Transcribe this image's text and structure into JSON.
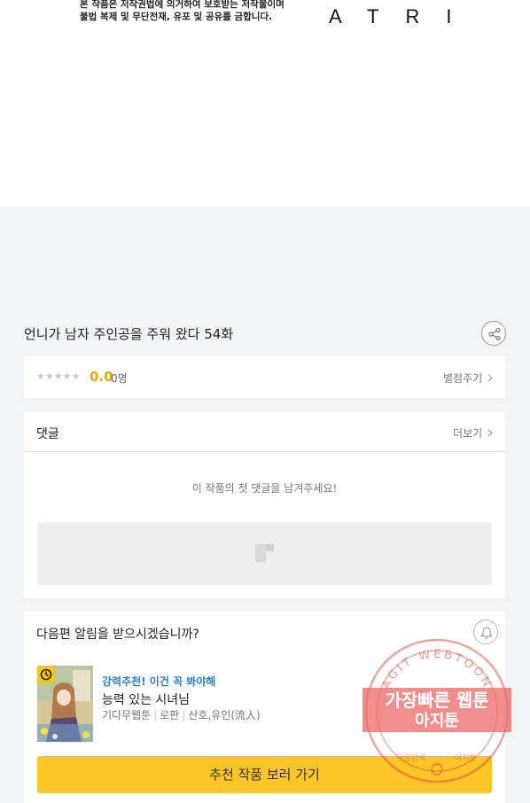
{
  "viewer": {
    "copyright_line1": "본 작품은 저작권법에 의거하여 보호받는 저작물이며",
    "copyright_line2": "불법 복제 및 무단전재, 유포 및 공유를 금합니다.",
    "brand": "ATRI"
  },
  "episode": {
    "title": "언니가 남자 주인공을 주워 왔다 54화"
  },
  "rating": {
    "stars": "★★★★★",
    "score": "0.0",
    "count": "0명",
    "rate_link": "별점주기"
  },
  "comments": {
    "label": "댓글",
    "more_link": "더보기",
    "empty_message": "이 작품의 첫 댓글을 남겨주세요!"
  },
  "notify": {
    "question": "다음편 알림을 받으시겠습니까?"
  },
  "recommendation": {
    "tag": "강력추천! 이건 꼭 봐야해",
    "title": "능력 있는 시녀님",
    "meta": [
      "기다무웹툰",
      "로판",
      "산호,유인(流人)"
    ],
    "button_label": "추천 작품 보러 가기"
  },
  "watermark": {
    "ring_text": "AGIT WEBTOON",
    "line1": "가장빠른 웹툰",
    "line2": "아지툰",
    "bottom_left": "구글검색",
    "bottom_right": "아지툰"
  },
  "colors": {
    "accent_yellow": "#ffc629",
    "score_orange": "#f0a800",
    "tag_blue": "#2f7fd6",
    "stamp_red": "#e03a3a"
  },
  "icons": {
    "share": "share-icon",
    "bell": "bell-icon",
    "clock": "clock-icon",
    "chevron": "chevron-right-icon",
    "comment_placeholder": "comment-placeholder-icon"
  }
}
